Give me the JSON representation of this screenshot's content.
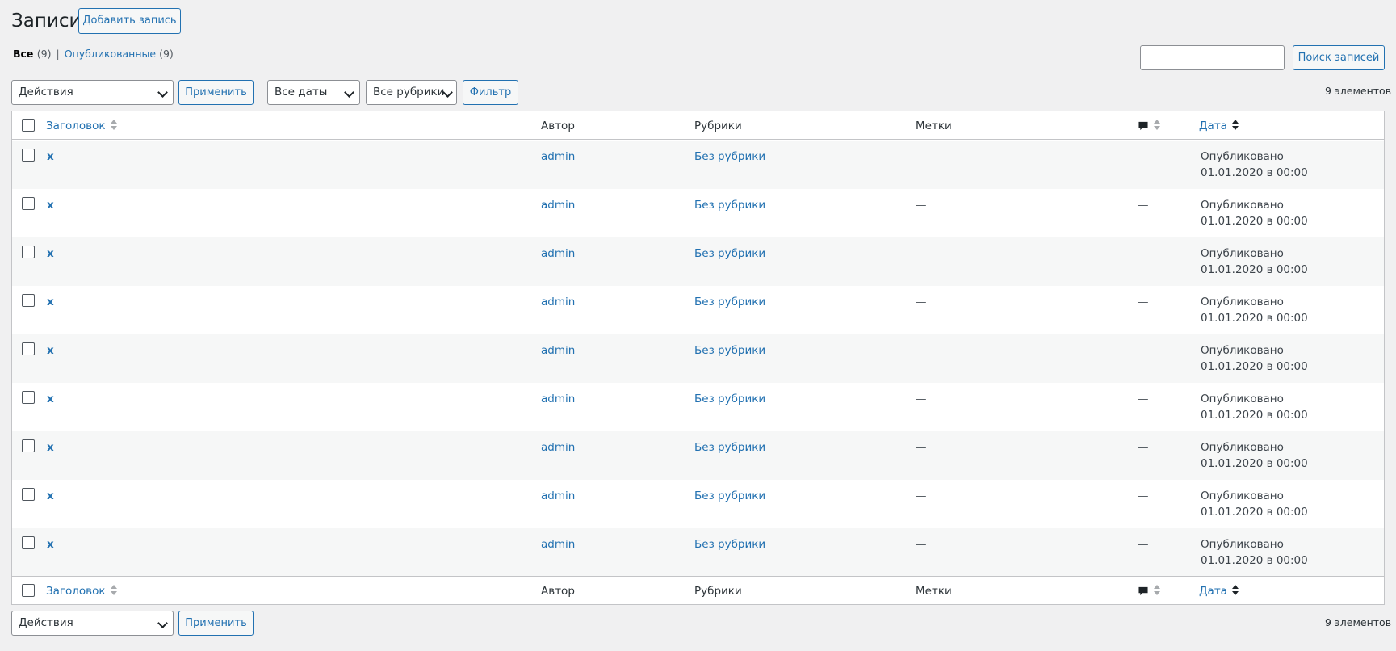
{
  "page": {
    "title": "Записи",
    "add_new_label": "Добавить запись"
  },
  "views": {
    "all_label": "Все",
    "all_count": "(9)",
    "separator": "|",
    "published_label": "Опубликованные",
    "published_count": "(9)"
  },
  "search": {
    "placeholder": "",
    "button_label": "Поиск записей"
  },
  "top_nav": {
    "bulk_action": "Действия",
    "apply_label": "Применить",
    "dates_filter": "Все даты",
    "category_filter": "Все рубрики",
    "filter_label": "Фильтр",
    "items_count": "9 элементов"
  },
  "bottom_nav": {
    "bulk_action": "Действия",
    "apply_label": "Применить",
    "items_count": "9 элементов"
  },
  "columns": {
    "title": "Заголовок",
    "author": "Автор",
    "categories": "Рубрики",
    "tags": "Метки",
    "comments_icon": "comment-bubble-icon",
    "date": "Дата"
  },
  "rows": [
    {
      "title": "x",
      "author": "admin",
      "category": "Без рубрики",
      "tags": "—",
      "comments": "—",
      "status": "Опубликовано",
      "date": "01.01.2020 в 00:00"
    },
    {
      "title": "x",
      "author": "admin",
      "category": "Без рубрики",
      "tags": "—",
      "comments": "—",
      "status": "Опубликовано",
      "date": "01.01.2020 в 00:00"
    },
    {
      "title": "x",
      "author": "admin",
      "category": "Без рубрики",
      "tags": "—",
      "comments": "—",
      "status": "Опубликовано",
      "date": "01.01.2020 в 00:00"
    },
    {
      "title": "x",
      "author": "admin",
      "category": "Без рубрики",
      "tags": "—",
      "comments": "—",
      "status": "Опубликовано",
      "date": "01.01.2020 в 00:00"
    },
    {
      "title": "x",
      "author": "admin",
      "category": "Без рубрики",
      "tags": "—",
      "comments": "—",
      "status": "Опубликовано",
      "date": "01.01.2020 в 00:00"
    },
    {
      "title": "x",
      "author": "admin",
      "category": "Без рубрики",
      "tags": "—",
      "comments": "—",
      "status": "Опубликовано",
      "date": "01.01.2020 в 00:00"
    },
    {
      "title": "x",
      "author": "admin",
      "category": "Без рубрики",
      "tags": "—",
      "comments": "—",
      "status": "Опубликовано",
      "date": "01.01.2020 в 00:00"
    },
    {
      "title": "x",
      "author": "admin",
      "category": "Без рубрики",
      "tags": "—",
      "comments": "—",
      "status": "Опубликовано",
      "date": "01.01.2020 в 00:00"
    },
    {
      "title": "x",
      "author": "admin",
      "category": "Без рубрики",
      "tags": "—",
      "comments": "—",
      "status": "Опубликовано",
      "date": "01.01.2020 в 00:00"
    }
  ],
  "colors": {
    "accent": "#2271b1",
    "background": "#f0f0f1",
    "row_alt": "#f6f7f7",
    "border": "#c3c4c7"
  }
}
